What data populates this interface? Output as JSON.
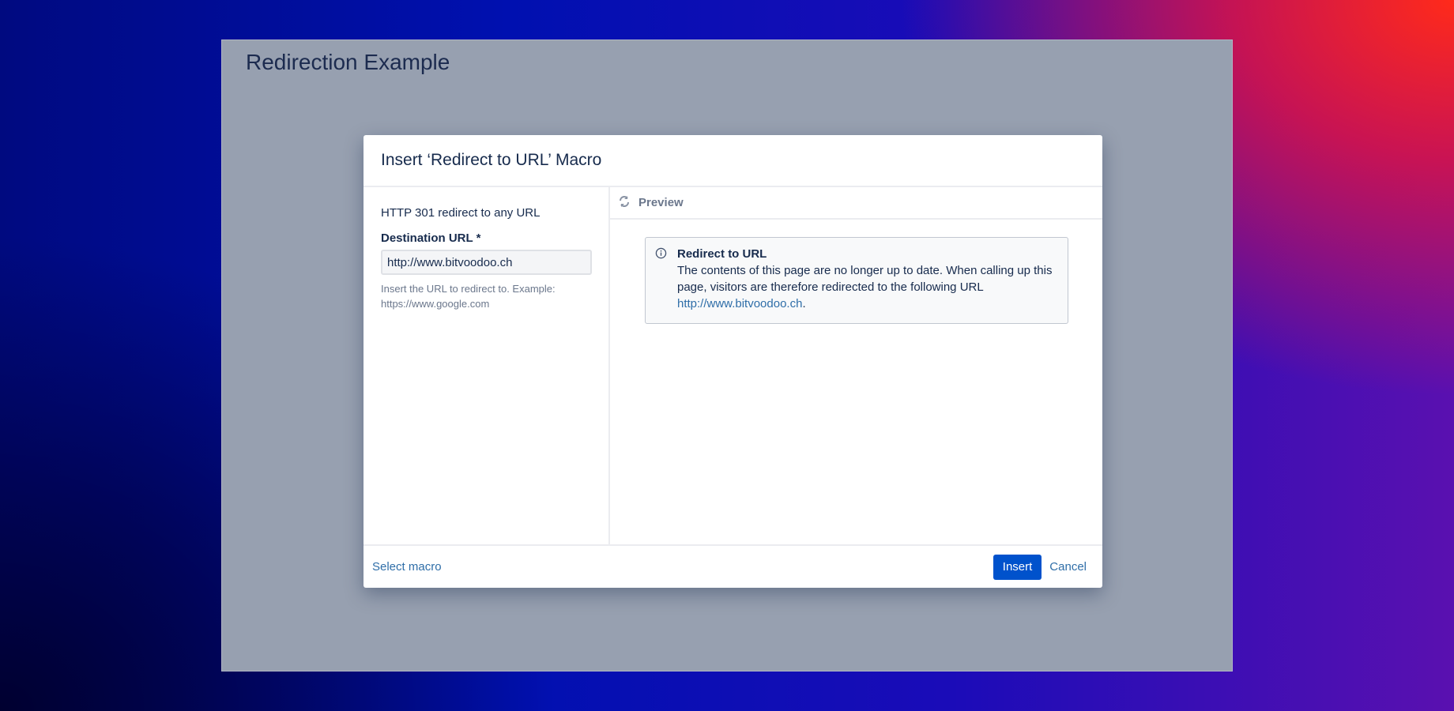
{
  "page": {
    "title": "Redirection Example"
  },
  "dialog": {
    "title": "Insert ‘Redirect to URL’ Macro",
    "description": "HTTP 301 redirect to any URL",
    "field_label": "Destination URL *",
    "field_value": "http://www.bitvoodoo.ch",
    "help_line1": "Insert the URL to redirect to. Example:",
    "help_line2": "https://www.google.com",
    "preview_label": "Preview",
    "info": {
      "title": "Redirect to URL",
      "text": "The contents of this page are no longer up to date. When calling up this page, visitors are therefore redirected to the following URL ",
      "link": "http://www.bitvoodoo.ch",
      "suffix": "."
    },
    "select_macro": "Select macro",
    "insert": "Insert",
    "cancel": "Cancel"
  }
}
